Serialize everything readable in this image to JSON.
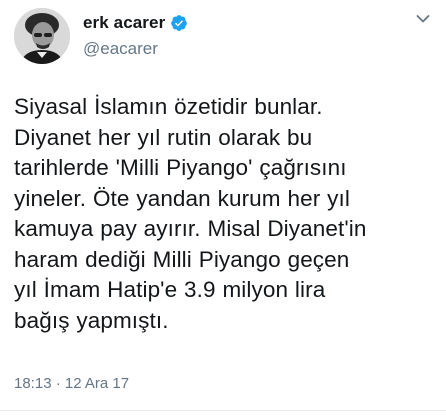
{
  "author": {
    "display_name": "erk acarer",
    "handle": "@eacarer",
    "verified": true,
    "avatar_icon": "profile-photo"
  },
  "tweet": {
    "lines": [
      "Siyasal İslamın özetidir bunlar.",
      "Diyanet her yıl rutin olarak bu",
      "tarihlerde 'Milli Piyango' çağrısını",
      "yineler. Öte yandan kurum her yıl",
      "kamuya pay ayırır. Misal Diyanet'in",
      "haram dediği Milli Piyango geçen",
      "yıl İmam Hatip'e 3.9 milyon lira",
      "bağış yapmıştı."
    ],
    "timestamp": "18:13 · 12 Ara 17"
  },
  "colors": {
    "text": "#14171a",
    "secondary": "#657786",
    "verified_blue": "#1da1f2",
    "divider": "#e6ecf0"
  }
}
